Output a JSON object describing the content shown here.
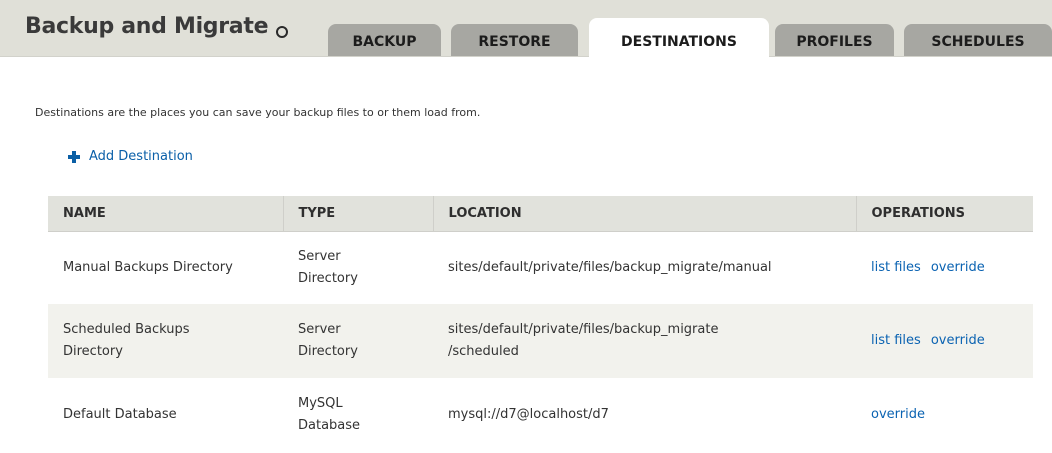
{
  "header": {
    "title": "Backup and Migrate"
  },
  "tabs": [
    {
      "label": "BACKUP"
    },
    {
      "label": "RESTORE"
    },
    {
      "label": "DESTINATIONS"
    },
    {
      "label": "PROFILES"
    },
    {
      "label": "SCHEDULES"
    }
  ],
  "main": {
    "description": "Destinations are the places you can save your backup files to or them load from.",
    "add_link": "Add Destination"
  },
  "table": {
    "headers": [
      "NAME",
      "TYPE",
      "LOCATION",
      "OPERATIONS"
    ],
    "rows": [
      {
        "name": "Manual Backups Directory",
        "type_line1": "Server",
        "type_line2": "Directory",
        "location_line1": "sites/default/private/files/backup_migrate/manual",
        "location_line2": "",
        "op1": "list files",
        "op2": "override"
      },
      {
        "name_line1": "Scheduled Backups",
        "name_line2": "Directory",
        "type_line1": "Server",
        "type_line2": "Directory",
        "location_line1": "sites/default/private/files/backup_migrate",
        "location_line2": "/scheduled",
        "op1": "list files",
        "op2": "override"
      },
      {
        "name": "Default Database",
        "type_line1": "MySQL",
        "type_line2": "Database",
        "location_line1": "mysql://d7@localhost/d7",
        "op1": "override"
      }
    ]
  },
  "icons": {
    "settings": "gear-icon",
    "add": "plus-icon"
  },
  "colors": {
    "link": "#0b63b2",
    "tab_inactive": "#a7a7a2",
    "header_bg": "#e0e0d8"
  }
}
